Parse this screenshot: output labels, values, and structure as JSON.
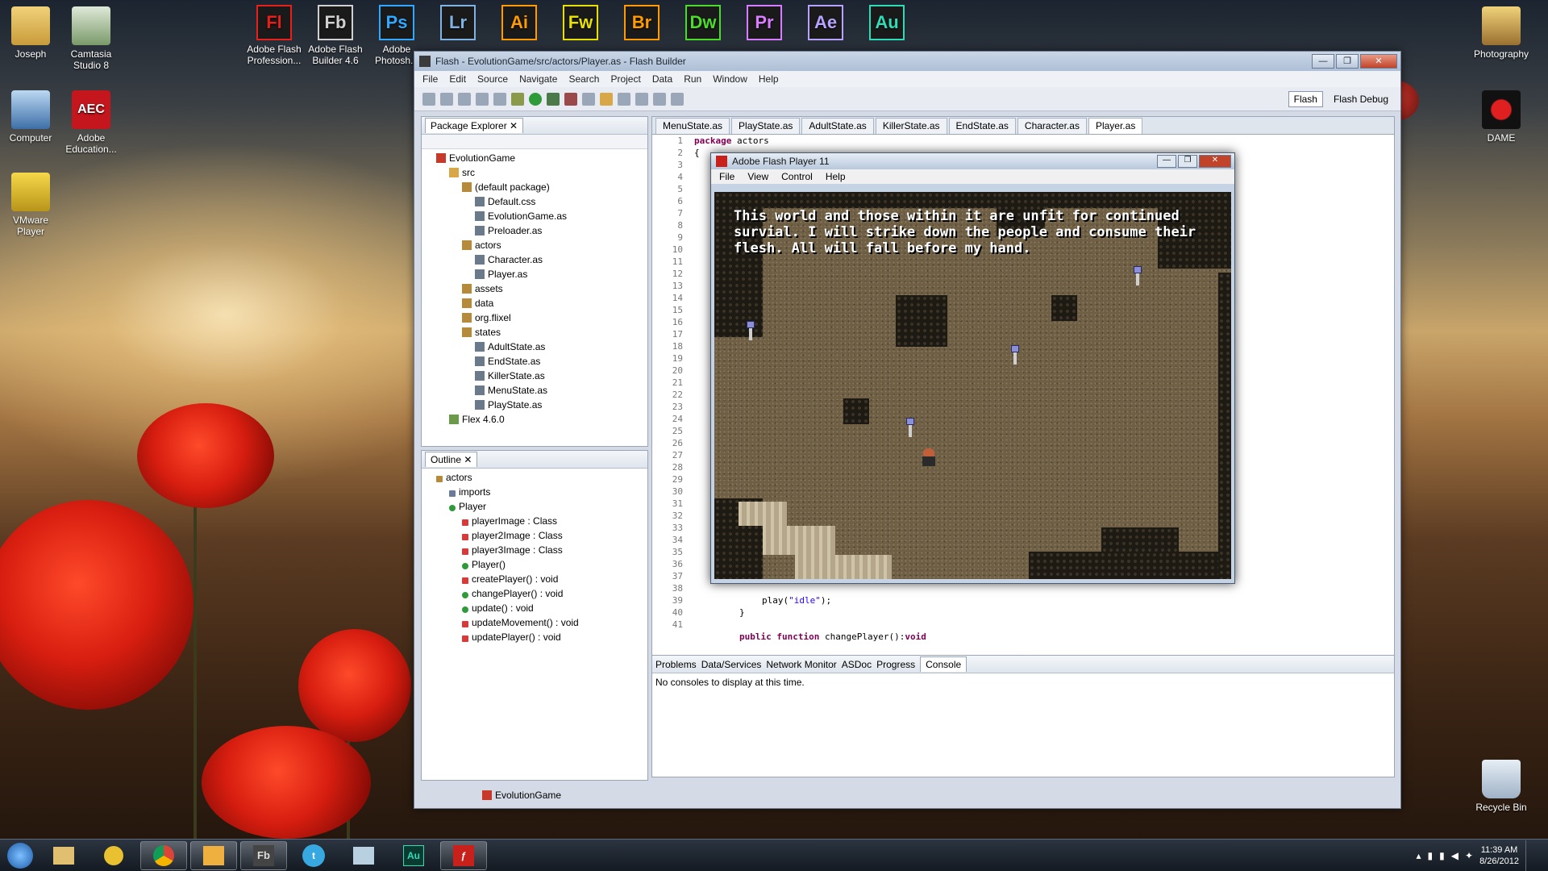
{
  "desktop": {
    "left_icons": [
      {
        "label": "Joseph",
        "icon": "user-folder-icon"
      },
      {
        "label": "Camtasia\nStudio 8",
        "icon": "camtasia-icon"
      },
      {
        "label": "Computer",
        "icon": "computer-icon"
      },
      {
        "label": "Adobe\nEducation...",
        "icon": "aec-icon"
      },
      {
        "label": "VMware\nPlayer",
        "icon": "vmware-icon"
      }
    ],
    "adobe_icons": [
      {
        "abbr": "Fl",
        "label": "Adobe Flash\nProfession...",
        "color": "#e8201b"
      },
      {
        "abbr": "Fb",
        "label": "Adobe Flash\nBuilder 4.6",
        "color": "#d0d0d0"
      },
      {
        "abbr": "Ps",
        "label": "Adobe\nPhotosh...",
        "color": "#31a8ff"
      },
      {
        "abbr": "Lr",
        "label": "",
        "color": "#7fb3e6"
      },
      {
        "abbr": "Ai",
        "label": "",
        "color": "#ff9a00"
      },
      {
        "abbr": "Fw",
        "label": "",
        "color": "#e7e000"
      },
      {
        "abbr": "Br",
        "label": "",
        "color": "#ff9a00"
      },
      {
        "abbr": "Dw",
        "label": "",
        "color": "#4bdb29"
      },
      {
        "abbr": "Pr",
        "label": "",
        "color": "#d97cff"
      },
      {
        "abbr": "Ae",
        "label": "",
        "color": "#b7a3ff"
      },
      {
        "abbr": "Au",
        "label": "",
        "color": "#2edcb8"
      }
    ],
    "right_icons": [
      {
        "label": "Photography",
        "icon": "photo-folder-icon"
      },
      {
        "label": "DAME",
        "icon": "dame-icon"
      },
      {
        "label": "Recycle Bin",
        "icon": "recycle-bin-icon"
      }
    ]
  },
  "window": {
    "title": "Flash - EvolutionGame/src/actors/Player.as - Flash Builder",
    "menu": [
      "File",
      "Edit",
      "Source",
      "Navigate",
      "Search",
      "Project",
      "Data",
      "Run",
      "Window",
      "Help"
    ],
    "perspectives": {
      "flash": "Flash",
      "flash_debug": "Flash Debug"
    }
  },
  "package_explorer": {
    "title": "Package Explorer",
    "tree": [
      {
        "label": "EvolutionGame",
        "depth": 0,
        "type": "project"
      },
      {
        "label": "src",
        "depth": 1,
        "type": "folder"
      },
      {
        "label": "(default package)",
        "depth": 2,
        "type": "package"
      },
      {
        "label": "Default.css",
        "depth": 3,
        "type": "file"
      },
      {
        "label": "EvolutionGame.as",
        "depth": 3,
        "type": "file"
      },
      {
        "label": "Preloader.as",
        "depth": 3,
        "type": "file"
      },
      {
        "label": "actors",
        "depth": 2,
        "type": "package"
      },
      {
        "label": "Character.as",
        "depth": 3,
        "type": "file"
      },
      {
        "label": "Player.as",
        "depth": 3,
        "type": "file"
      },
      {
        "label": "assets",
        "depth": 2,
        "type": "package"
      },
      {
        "label": "data",
        "depth": 2,
        "type": "package"
      },
      {
        "label": "org.flixel",
        "depth": 2,
        "type": "package"
      },
      {
        "label": "states",
        "depth": 2,
        "type": "package"
      },
      {
        "label": "AdultState.as",
        "depth": 3,
        "type": "file"
      },
      {
        "label": "EndState.as",
        "depth": 3,
        "type": "file"
      },
      {
        "label": "KillerState.as",
        "depth": 3,
        "type": "file"
      },
      {
        "label": "MenuState.as",
        "depth": 3,
        "type": "file"
      },
      {
        "label": "PlayState.as",
        "depth": 3,
        "type": "file"
      },
      {
        "label": "Flex 4.6.0",
        "depth": 1,
        "type": "lib"
      }
    ]
  },
  "outline": {
    "title": "Outline",
    "items": [
      {
        "label": "actors",
        "depth": 0,
        "type": "package"
      },
      {
        "label": "imports",
        "depth": 1,
        "type": "imports"
      },
      {
        "label": "Player",
        "depth": 1,
        "type": "class"
      },
      {
        "label": "playerImage : Class",
        "depth": 2,
        "type": "private"
      },
      {
        "label": "player2Image : Class",
        "depth": 2,
        "type": "private"
      },
      {
        "label": "player3Image : Class",
        "depth": 2,
        "type": "private"
      },
      {
        "label": "Player()",
        "depth": 2,
        "type": "public"
      },
      {
        "label": "createPlayer() : void",
        "depth": 2,
        "type": "private"
      },
      {
        "label": "changePlayer() : void",
        "depth": 2,
        "type": "public"
      },
      {
        "label": "update() : void",
        "depth": 2,
        "type": "public"
      },
      {
        "label": "updateMovement() : void",
        "depth": 2,
        "type": "private"
      },
      {
        "label": "updatePlayer() : void",
        "depth": 2,
        "type": "private"
      }
    ]
  },
  "editor": {
    "tabs": [
      "MenuState.as",
      "PlayState.as",
      "AdultState.as",
      "KillerState.as",
      "EndState.as",
      "Character.as",
      "Player.as"
    ],
    "active_tab": "Player.as",
    "line_numbers": [
      "1",
      "2",
      "3",
      "4",
      "5",
      "6",
      "7",
      "8",
      "9",
      "10",
      "11",
      "12",
      "13",
      "14",
      "15",
      "16",
      "17",
      "18",
      "19",
      "20",
      "21",
      "22",
      "23",
      "24",
      "25",
      "26",
      "27",
      "28",
      "29",
      "30",
      "31",
      "32",
      "33",
      "34",
      "35",
      "36",
      "37",
      "38",
      "39",
      "40",
      "41"
    ],
    "line1_kw": "package",
    "line1_rest": " actors",
    "line2": "{",
    "line38_fn": "play(",
    "line38_str": "\"idle\"",
    "line38_end": ");",
    "line39": "}",
    "line41_kw1": "public",
    "line41_kw2": "function",
    "line41_name": " changePlayer():",
    "line41_type": "void"
  },
  "bottom_panel": {
    "tabs": [
      "Problems",
      "Data/Services",
      "Network Monitor",
      "ASDoc",
      "Progress",
      "Console"
    ],
    "active_tab": "Console",
    "message": "No consoles to display at this time."
  },
  "status_bar": {
    "project": "EvolutionGame"
  },
  "flash_player": {
    "title": "Adobe Flash Player 11",
    "menu": [
      "File",
      "View",
      "Control",
      "Help"
    ],
    "game_text": "This world and those within it are unfit for continued survial. I will strike down the people and consume their flesh. All will fall before my hand."
  },
  "taskbar": {
    "apps": [
      "explorer",
      "winamp",
      "chrome",
      "outlook",
      "flash-builder",
      "twitter",
      "notepad",
      "audition",
      "flash-player"
    ],
    "time": "11:39 AM",
    "date": "8/26/2012"
  }
}
